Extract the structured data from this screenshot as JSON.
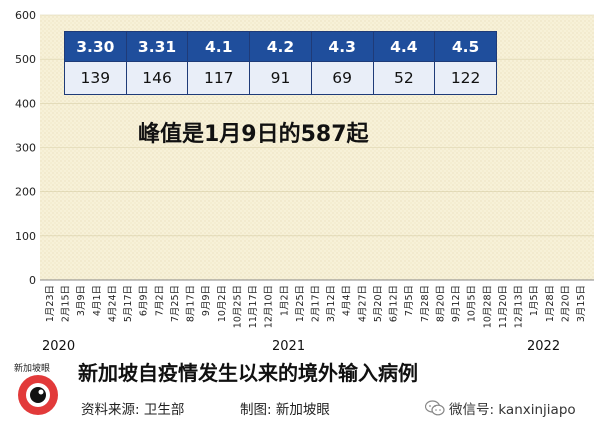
{
  "chart_data": {
    "type": "bar",
    "ylim": [
      0,
      600
    ],
    "yticks": [
      0,
      100,
      200,
      300,
      400,
      500,
      600
    ],
    "xtick_labels": [
      "1月23日",
      "2月15日",
      "3月9日",
      "4月1日",
      "4月24日",
      "5月17日",
      "6月9日",
      "7月2日",
      "7月25日",
      "8月17日",
      "9月9日",
      "10月2日",
      "10月25日",
      "11月17日",
      "12月10日",
      "1月2日",
      "1月25日",
      "2月17日",
      "3月12日",
      "4月4日",
      "4月27日",
      "5月20日",
      "6月12日",
      "7月5日",
      "7月28日",
      "8月20日",
      "9月12日",
      "10月5日",
      "10月28日",
      "11月20日",
      "12月13日",
      "1月5日",
      "1月28日",
      "2月20日",
      "3月15日"
    ],
    "year_labels": [
      "2020",
      "2021",
      "2022"
    ],
    "peak": {
      "date": "1月9日",
      "value": 587
    },
    "series": [
      {
        "color": "#1f3f7a",
        "values": [
          0,
          0,
          0,
          0,
          0,
          0,
          0,
          0,
          0,
          0,
          0,
          0,
          0,
          0,
          0,
          0,
          0,
          0,
          0,
          0,
          0,
          0,
          0,
          0,
          0,
          0,
          0,
          0,
          0,
          0,
          0,
          0,
          0,
          0,
          0,
          0,
          0,
          0,
          0,
          0,
          0,
          0,
          0,
          0,
          0,
          0,
          0,
          0,
          0,
          0,
          0,
          0,
          0,
          0,
          0,
          0,
          0,
          0,
          0,
          0,
          0,
          0,
          0,
          0,
          0,
          0,
          0,
          0,
          0,
          0,
          0,
          0,
          0,
          0,
          0,
          0,
          0,
          0,
          0,
          0,
          0,
          0,
          0,
          0,
          0,
          0,
          0,
          0,
          0,
          0,
          0,
          0,
          0,
          0,
          0,
          0,
          0,
          0,
          0,
          0,
          0,
          0,
          0,
          0,
          0,
          0,
          0,
          0,
          0,
          0,
          0,
          0,
          0,
          0,
          0,
          0,
          0,
          0,
          0,
          0,
          0,
          0,
          0,
          0,
          0,
          0,
          0,
          0,
          0,
          0,
          0,
          0,
          0,
          0,
          0,
          0,
          0,
          0,
          0,
          0,
          0,
          0,
          0,
          0,
          0,
          0,
          0,
          0,
          0,
          0,
          0,
          0,
          0,
          0,
          0,
          0,
          0,
          0,
          0,
          0,
          0,
          0,
          0,
          0,
          0,
          0,
          0,
          0,
          0,
          0,
          0,
          0,
          0,
          0,
          0,
          0,
          0,
          0,
          0,
          0,
          0,
          0,
          0,
          0,
          0,
          0,
          0,
          0,
          0,
          0,
          0,
          0,
          0,
          0,
          0,
          0,
          0,
          0,
          0,
          0,
          0,
          0,
          0,
          0,
          0,
          0,
          0,
          0,
          0,
          0,
          0,
          0,
          0,
          0,
          0,
          0,
          0,
          0,
          0,
          0,
          0,
          0,
          0,
          0,
          0,
          0,
          0,
          0,
          0,
          0,
          0,
          0,
          0,
          0,
          0,
          0,
          0,
          0,
          0,
          0,
          0,
          0,
          0,
          0,
          0,
          0,
          0,
          0,
          0,
          0,
          0,
          0,
          0,
          0,
          0,
          0,
          0,
          0,
          0,
          0,
          0,
          0,
          0,
          0,
          0,
          0,
          0,
          0,
          0,
          0,
          0,
          0,
          0,
          0,
          0,
          0,
          0,
          0,
          0,
          0,
          0,
          0,
          0,
          0,
          0,
          0,
          0,
          0,
          0,
          0,
          0,
          0,
          0,
          0,
          0,
          0,
          0,
          0,
          0,
          0,
          0,
          0,
          0,
          0,
          0,
          0,
          0,
          0,
          0,
          0,
          0,
          0,
          0,
          0,
          0,
          0,
          0,
          0,
          0,
          0,
          0,
          0,
          0,
          0,
          0,
          0,
          0,
          0,
          0,
          0,
          0,
          0,
          0,
          0,
          0,
          0,
          0,
          0,
          0,
          0,
          0,
          0,
          0,
          0,
          0,
          0,
          0,
          0,
          0,
          0,
          0,
          0,
          0,
          0,
          0,
          0,
          0,
          0,
          0,
          0,
          0,
          0,
          0,
          0,
          0,
          0,
          0,
          0,
          0,
          0,
          0,
          0,
          0,
          0,
          0,
          0,
          0,
          0,
          0,
          0,
          0,
          0,
          0,
          0,
          0,
          0,
          0,
          0,
          0,
          0,
          0,
          0,
          0,
          0,
          0,
          0,
          0,
          0,
          0,
          0,
          0,
          0,
          0,
          0,
          0,
          0,
          0,
          0,
          0,
          0,
          0,
          0,
          0,
          0,
          0,
          0,
          0,
          0,
          0,
          0,
          0,
          0,
          0,
          0,
          0,
          0,
          0,
          0,
          0,
          0,
          0,
          0,
          0,
          0,
          0,
          0,
          0,
          0,
          0,
          0,
          0,
          0,
          0,
          0,
          0,
          0,
          0,
          0,
          0,
          0,
          0,
          0,
          0,
          0,
          0,
          0,
          0,
          0,
          0,
          0,
          0,
          0,
          0,
          0,
          0,
          0,
          0,
          0,
          0,
          0,
          0,
          0,
          0,
          0,
          0,
          0,
          0,
          0,
          0,
          0,
          0,
          0,
          0,
          0,
          0,
          0,
          0,
          0,
          0,
          0,
          0,
          0,
          0,
          0,
          0,
          0,
          0,
          0,
          0,
          0,
          0,
          0,
          0,
          0,
          0,
          0,
          0,
          0,
          0,
          0,
          0,
          0,
          0,
          0,
          0,
          0,
          0,
          0,
          0,
          0,
          0,
          0,
          0,
          0,
          0,
          0,
          0,
          0,
          0,
          0,
          0,
          0,
          0,
          0,
          0,
          0,
          0,
          0,
          0,
          0,
          0,
          0,
          0,
          0,
          0,
          0,
          0,
          0,
          0,
          0,
          0,
          0,
          0,
          0,
          0,
          0,
          0,
          0,
          0,
          0,
          0,
          0,
          0,
          0,
          0,
          0,
          0,
          0,
          0,
          0,
          0,
          0,
          0,
          0,
          0,
          0,
          0,
          0,
          0,
          0,
          0,
          0,
          0,
          0,
          0,
          0,
          0,
          0,
          0,
          0,
          0,
          0,
          0,
          0,
          0,
          0,
          0,
          0,
          0,
          0,
          0,
          0,
          0,
          0,
          0,
          0,
          0,
          0,
          0,
          0,
          0,
          0,
          0,
          0,
          0,
          0,
          0,
          0,
          0,
          0,
          0,
          0,
          0,
          0,
          0,
          0,
          0,
          0,
          0,
          0,
          0,
          0,
          0,
          0,
          0,
          0,
          0,
          0,
          0,
          0,
          0,
          0,
          0,
          0,
          0,
          0,
          0,
          0,
          0,
          0,
          0,
          0,
          0,
          0,
          0,
          0,
          0,
          0,
          0,
          0,
          0,
          0,
          0,
          0,
          0,
          0,
          0,
          0,
          0,
          0,
          0,
          0,
          0,
          0,
          0,
          0,
          0,
          0,
          0,
          0,
          0,
          0,
          0,
          0,
          0,
          0,
          0,
          0,
          0,
          0,
          0,
          0,
          0,
          0,
          0,
          0,
          0,
          0,
          0,
          0,
          0,
          0,
          0,
          0,
          0,
          0,
          0,
          0,
          0,
          0,
          0,
          0,
          0,
          0,
          0,
          0,
          0,
          0,
          0,
          0,
          0,
          0,
          0,
          0,
          0,
          0,
          0,
          0,
          0,
          0,
          0,
          0,
          0,
          0,
          0,
          0,
          0,
          0,
          0,
          0,
          0,
          0,
          0,
          0,
          0,
          0,
          0,
          0,
          0,
          0,
          0,
          0,
          0,
          0,
          0,
          0,
          0,
          0,
          0,
          0,
          0,
          0,
          0,
          0,
          0,
          0,
          0,
          0,
          0,
          0,
          0,
          0,
          0,
          0,
          0,
          0,
          0,
          0,
          0,
          0,
          0,
          0,
          0,
          0,
          0,
          0,
          0,
          0,
          0,
          0,
          0,
          0,
          0,
          0,
          0,
          0,
          0,
          0,
          0,
          0,
          0,
          0,
          0,
          0,
          0,
          0,
          0,
          0,
          0,
          0,
          0,
          0,
          0,
          0,
          0,
          0,
          0,
          0,
          0,
          0,
          0,
          0,
          0,
          0,
          0,
          0,
          0,
          0,
          0,
          0,
          0,
          0,
          0,
          0,
          0,
          0,
          0,
          0,
          0,
          0,
          0,
          0,
          0,
          0,
          0,
          0,
          0,
          0,
          0,
          0,
          0,
          0,
          0,
          0,
          0,
          0,
          0,
          0,
          0,
          0,
          0,
          0,
          0,
          0,
          0,
          0,
          0,
          0,
          0,
          0,
          0,
          0,
          0,
          0,
          0,
          0,
          0,
          0,
          0,
          0,
          0,
          0,
          0,
          0,
          0,
          0,
          0,
          0,
          0,
          0,
          0,
          0,
          0,
          0,
          0,
          0,
          0,
          0,
          0,
          0,
          0,
          0,
          0,
          0,
          0,
          0,
          0,
          0,
          0,
          0,
          0,
          0,
          0,
          0,
          0,
          0,
          0,
          0,
          0,
          0,
          0,
          0,
          0,
          0,
          0,
          0,
          0,
          0,
          0,
          0,
          0,
          0,
          0,
          0,
          0,
          0,
          0,
          0,
          0,
          0,
          0,
          0,
          0,
          0,
          0,
          0,
          0,
          0,
          0,
          0,
          0,
          0,
          0,
          0,
          0,
          0,
          0,
          0,
          0,
          0,
          0,
          0,
          0,
          0,
          0,
          0,
          0,
          0,
          0,
          0,
          0,
          0,
          0,
          0,
          0,
          0,
          0,
          0,
          0,
          0,
          0,
          0,
          0,
          0,
          0,
          0,
          0,
          0,
          0,
          0,
          0,
          0,
          0,
          0,
          0,
          0,
          0,
          0,
          0,
          0,
          0,
          0,
          0,
          0,
          0,
          0,
          0,
          0,
          0,
          0,
          0,
          0,
          0,
          0,
          0,
          0,
          0,
          0,
          0,
          0,
          0,
          0,
          0,
          0,
          0,
          0,
          0,
          0,
          0,
          0,
          0,
          0,
          0,
          0,
          0,
          0,
          0,
          0,
          0,
          0,
          0,
          0,
          0,
          0,
          0
        ]
      }
    ]
  },
  "table": {
    "dates": [
      "3.30",
      "3.31",
      "4.1",
      "4.2",
      "4.3",
      "4.4",
      "4.5"
    ],
    "values": [
      "139",
      "146",
      "117",
      "91",
      "69",
      "52",
      "122"
    ]
  },
  "peak_note": "峰值是1月9日的587起",
  "bottom_title": "新加坡自疫情发生以来的境外输入病例",
  "source": "资料来源:   卫生部",
  "maker": "制图:   新加坡眼",
  "logo_text": "新加坡眼",
  "wechat": "微信号: kanxinjiapo",
  "colors": {
    "bar": "#1f3f7a",
    "table_header": "#1f4e9c",
    "table_body": "#e9eef8"
  }
}
